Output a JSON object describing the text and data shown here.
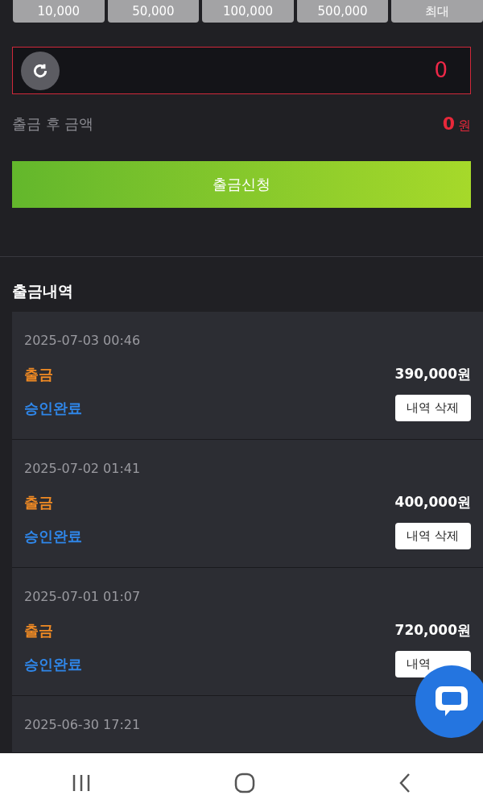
{
  "amount_buttons": [
    "10,000",
    "50,000",
    "100,000",
    "500,000",
    "최대"
  ],
  "amount_field": {
    "value": "0"
  },
  "after_balance": {
    "label": "출금 후 금액",
    "value": "0",
    "unit": "원"
  },
  "submit_button": "출금신청",
  "history": {
    "title": "출금내역",
    "items": [
      {
        "date": "2025-07-03 00:46",
        "type": "출금",
        "amount": "390,000원",
        "status": "승인완료",
        "delete_button": "내역 삭제"
      },
      {
        "date": "2025-07-02 01:41",
        "type": "출금",
        "amount": "400,000원",
        "status": "승인완료",
        "delete_button": "내역 삭제"
      },
      {
        "date": "2025-07-01 01:07",
        "type": "출금",
        "amount": "720,000원",
        "status": "승인완료",
        "delete_button": "내역"
      },
      {
        "date": "2025-06-30 17:21"
      }
    ]
  }
}
